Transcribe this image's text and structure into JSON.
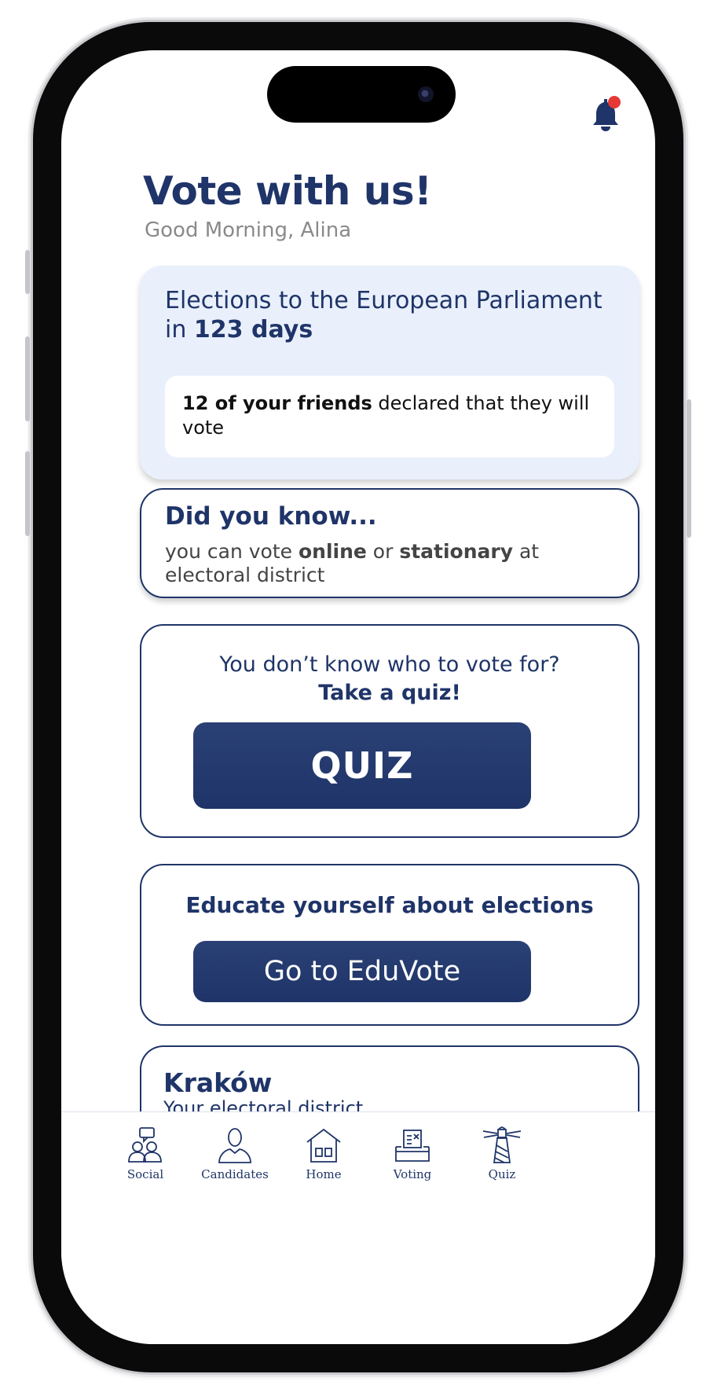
{
  "header": {
    "title": "Vote with us!",
    "greeting": "Good Morning, Alina"
  },
  "notification": {
    "icon": "bell-icon",
    "has_unread": true,
    "badge_color": "#e53935"
  },
  "election_card": {
    "line1": "Elections to the European Parliament",
    "in_word": "in",
    "days": "123 days",
    "friends_bold": "12 of your friends",
    "friends_rest": "declared that they will vote"
  },
  "did_you_know": {
    "title": "Did you know...",
    "text_pre": "you can vote",
    "online": "online",
    "or": "or",
    "stationary": "stationary",
    "text_post": "at electoral district"
  },
  "quiz_card": {
    "question": "You don’t know who to vote for?",
    "cta": "Take a quiz!",
    "button": "QUIZ"
  },
  "edu_card": {
    "title": "Educate yourself about elections",
    "button": "Go to EduVote"
  },
  "district_card": {
    "city": "Kraków",
    "subtitle": "Your electoral district"
  },
  "nav": {
    "items": [
      {
        "label": "Social",
        "icon": "social-icon"
      },
      {
        "label": "Candidates",
        "icon": "candidates-icon"
      },
      {
        "label": "Home",
        "icon": "home-icon"
      },
      {
        "label": "Voting",
        "icon": "voting-icon"
      },
      {
        "label": "Quiz",
        "icon": "lighthouse-icon"
      }
    ]
  },
  "colors": {
    "primary": "#1f3468",
    "card_bg": "#e9f0fc",
    "muted_text": "#8a8a8a"
  }
}
